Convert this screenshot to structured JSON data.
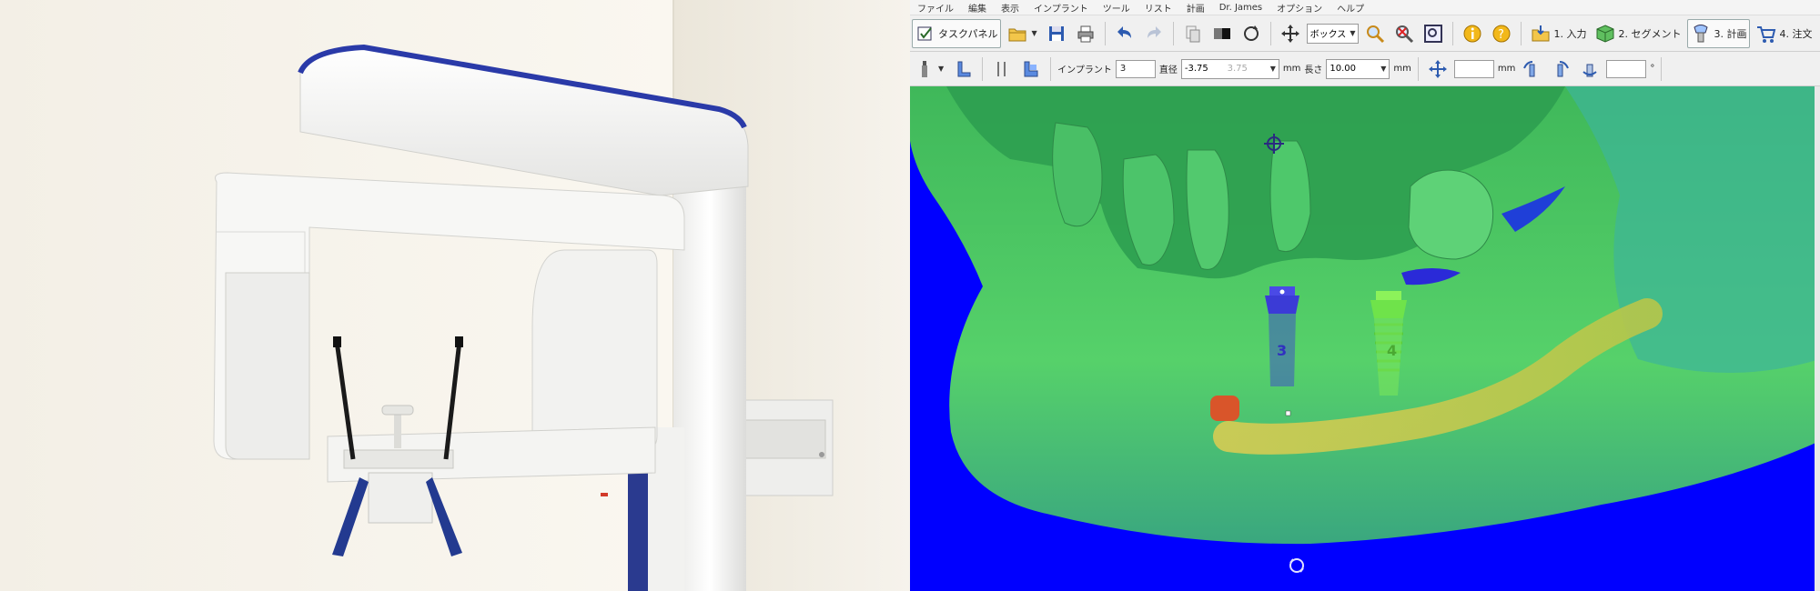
{
  "menubar": {
    "items": [
      "ファイル",
      "編集",
      "表示",
      "インプラント",
      "ツール",
      "リスト",
      "計画",
      "Dr. James",
      "オプション",
      "ヘルプ"
    ]
  },
  "toolbar1": {
    "task_panel_label": "タスクパネル",
    "select_value": "ボックス",
    "step1_label": "1. 入力",
    "step2_label": "2. セグメント",
    "step3_label": "3. 計画",
    "step4_label": "4. 注文"
  },
  "toolbar2": {
    "implant_label": "インプラント",
    "implant_value": "3",
    "diameter_label": "直径",
    "diameter_value": "-3.75",
    "diameter_dim_value": "3.75",
    "unit_mm": "mm",
    "length_label": "長さ",
    "length_value": "10.00"
  },
  "viewport": {
    "implant_left_number": "3",
    "implant_right_number": "4"
  },
  "colors": {
    "background_blue": "#0000ff",
    "bone_green": "#4dcc5c",
    "implant_blue": "#3b3bd6",
    "implant_green": "#6fe34a",
    "nerve_canal": "#c9c94a",
    "marker_red": "#d9552a"
  }
}
